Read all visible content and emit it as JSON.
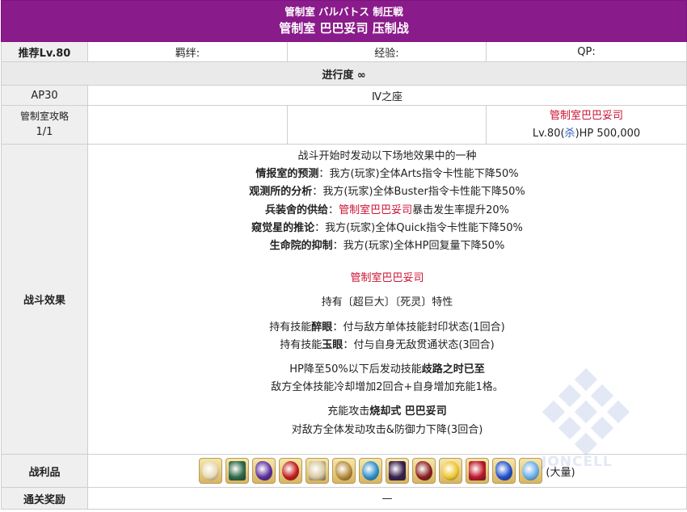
{
  "header": {
    "jp_title": "管制室 バルバトス 制圧戦",
    "cn_title": "管制室 巴巴妥司 压制战"
  },
  "info_row": {
    "recommend": "推荐Lv.80",
    "bond": "羁绊:",
    "exp": "经验:",
    "qp": "QP:"
  },
  "progress": "进行度 ∞",
  "ap_row": {
    "ap": "AP30",
    "location": "Ⅳ之座"
  },
  "stage": {
    "label": "管制室攻略",
    "count": "1/1",
    "enemy_name": "管制室巴巴妥司",
    "enemy_level": "Lv.80(",
    "enemy_class": "杀",
    "enemy_hp": ")HP 500,000"
  },
  "battle_effects": {
    "label": "战斗效果",
    "intro": "战斗开始时发动以下场地效果中的一种",
    "fields": [
      {
        "name": "情报室的预测",
        "sep": "：",
        "text": "我方(玩家)全体Arts指令卡性能下降50%"
      },
      {
        "name": "观测所的分析",
        "sep": "：",
        "text": "我方(玩家)全体Buster指令卡性能下降50%"
      },
      {
        "name": "兵装舍的供给",
        "sep": "：",
        "red": "管制室巴巴妥司",
        "text": "暴击发生率提升20%"
      },
      {
        "name": "窥觉星的推论",
        "sep": "：",
        "text": "我方(玩家)全体Quick指令卡性能下降50%"
      },
      {
        "name": "生命院的抑制",
        "sep": "：",
        "text": "我方(玩家)全体HP回复量下降50%"
      }
    ],
    "boss_name": "管制室巴巴妥司",
    "traits": "持有〔超巨大〕〔死灵〕特性",
    "skill1_pre": "持有技能",
    "skill1_name": "醉眼",
    "skill1_text": "：付与敌方单体技能封印状态(1回合)",
    "skill2_pre": "持有技能",
    "skill2_name": "玉眼",
    "skill2_text": "：付与自身无敌贯通状态(3回合)",
    "hp_pre": "HP降至50%以下后发动技能",
    "hp_skill": "歧路之时已至",
    "hp_text": "敌方全体技能冷却增加2回合+自身增加充能1格。",
    "np_pre": "充能攻击",
    "np_name": "烧却式 巴巴妥司",
    "np_text": "对敌方全体发动攻击&防御力下降(3回合)"
  },
  "loot": {
    "label": "战利品",
    "items": [
      {
        "icon": "doll-card-icon",
        "color": "#e8d9b0"
      },
      {
        "icon": "green-wing-icon",
        "color": "#2f6b4a"
      },
      {
        "icon": "purple-claw-icon",
        "color": "#5a2d9c"
      },
      {
        "icon": "red-orb-icon",
        "color": "#c41a1a"
      },
      {
        "icon": "scroll-icon",
        "color": "#d9c9a0"
      },
      {
        "icon": "scale-icon",
        "color": "#b58a3a"
      },
      {
        "icon": "blue-lantern-icon",
        "color": "#2d8fc9"
      },
      {
        "icon": "dark-crystal-icon",
        "color": "#3a1f4f"
      },
      {
        "icon": "bone-staff-icon",
        "color": "#8a1e1e"
      },
      {
        "icon": "gold-star-icon",
        "color": "#f0c62e"
      },
      {
        "icon": "red-gem-icon",
        "color": "#c0182a"
      },
      {
        "icon": "blue-orb-icon",
        "color": "#1f4fc9"
      },
      {
        "icon": "blue-crystal-icon",
        "color": "#6aaee8"
      }
    ],
    "suffix": "(大量)"
  },
  "clear_reward": {
    "label": "通关奖励",
    "value": "—"
  },
  "watermark_text": "JONCELL"
}
